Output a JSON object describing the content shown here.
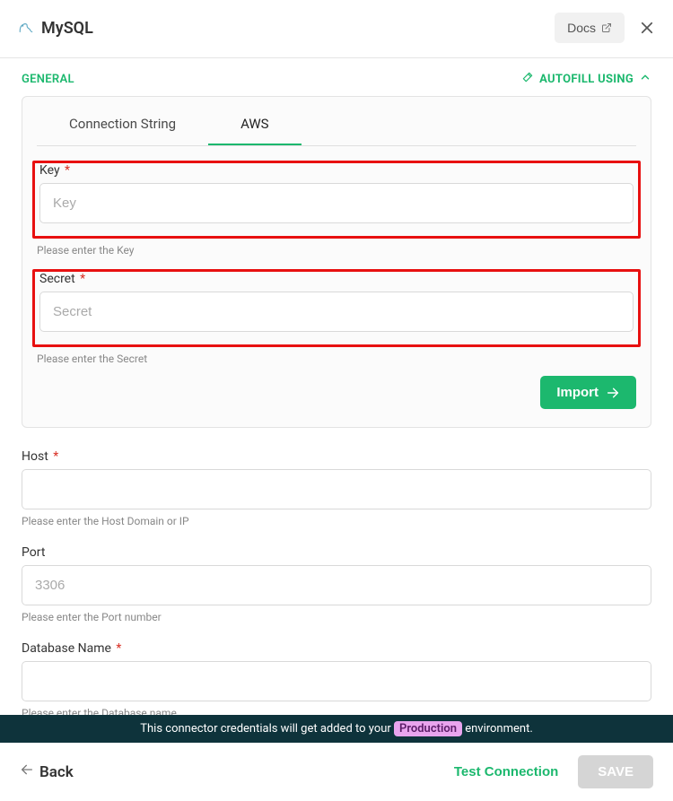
{
  "header": {
    "title": "MySQL",
    "docs_label": "Docs"
  },
  "subheader": {
    "general_label": "GENERAL",
    "autofill_label": "AUTOFILL USING"
  },
  "tabs": {
    "connection_string": "Connection String",
    "aws": "AWS"
  },
  "aws": {
    "key": {
      "label": "Key",
      "placeholder": "Key",
      "value": "",
      "helper": "Please enter the Key"
    },
    "secret": {
      "label": "Secret",
      "placeholder": "Secret",
      "value": "",
      "helper": "Please enter the Secret"
    },
    "import_label": "Import"
  },
  "fields": {
    "host": {
      "label": "Host",
      "placeholder": "",
      "value": "",
      "helper": "Please enter the Host Domain or IP"
    },
    "port": {
      "label": "Port",
      "placeholder": "3306",
      "value": "",
      "helper": "Please enter the Port number"
    },
    "database_name": {
      "label": "Database Name",
      "placeholder": "",
      "value": "",
      "helper": "Please enter the Database name"
    }
  },
  "notice": {
    "prefix": "This connector credentials will get added to your ",
    "badge": "Production",
    "suffix": " environment."
  },
  "footer": {
    "back_label": "Back",
    "test_connection_label": "Test Connection",
    "save_label": "SAVE"
  }
}
